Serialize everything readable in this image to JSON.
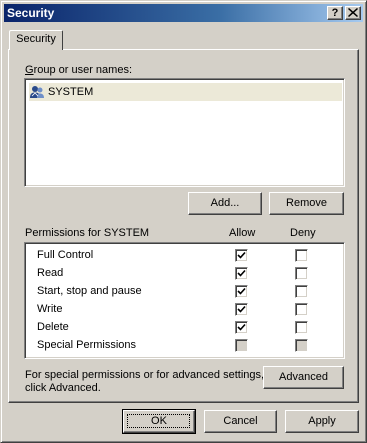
{
  "window": {
    "title": "Security",
    "help_button": "?",
    "close_button": "✕"
  },
  "tabs": [
    {
      "label": "Security",
      "active": true
    }
  ],
  "group_section": {
    "label": "Group or user names:",
    "label_access_key": "G",
    "users": [
      {
        "name": "SYSTEM",
        "icon": "users-group-icon",
        "selected": true
      }
    ]
  },
  "user_buttons": {
    "add": "Add...",
    "remove": "Remove"
  },
  "permissions": {
    "header": "Permissions for SYSTEM",
    "allow_header": "Allow",
    "deny_header": "Deny",
    "rows": [
      {
        "name": "Full Control",
        "allow": true,
        "deny": false,
        "disabled": false
      },
      {
        "name": "Read",
        "allow": true,
        "deny": false,
        "disabled": false
      },
      {
        "name": "Start, stop and pause",
        "allow": true,
        "deny": false,
        "disabled": false
      },
      {
        "name": "Write",
        "allow": true,
        "deny": false,
        "disabled": false
      },
      {
        "name": "Delete",
        "allow": true,
        "deny": false,
        "disabled": false
      },
      {
        "name": "Special Permissions",
        "allow": false,
        "deny": false,
        "disabled": true
      }
    ]
  },
  "advanced_section": {
    "text_line1": "For special permissions or for advanced settings,",
    "text_line2": "click Advanced.",
    "button": "Advanced"
  },
  "dialog_buttons": {
    "ok": "OK",
    "cancel": "Cancel",
    "apply": "Apply"
  },
  "colors": {
    "titlebar_start": "#0a246a",
    "titlebar_end": "#a6caf0",
    "face": "#d4d0c8",
    "selection": "#ece9d8"
  }
}
